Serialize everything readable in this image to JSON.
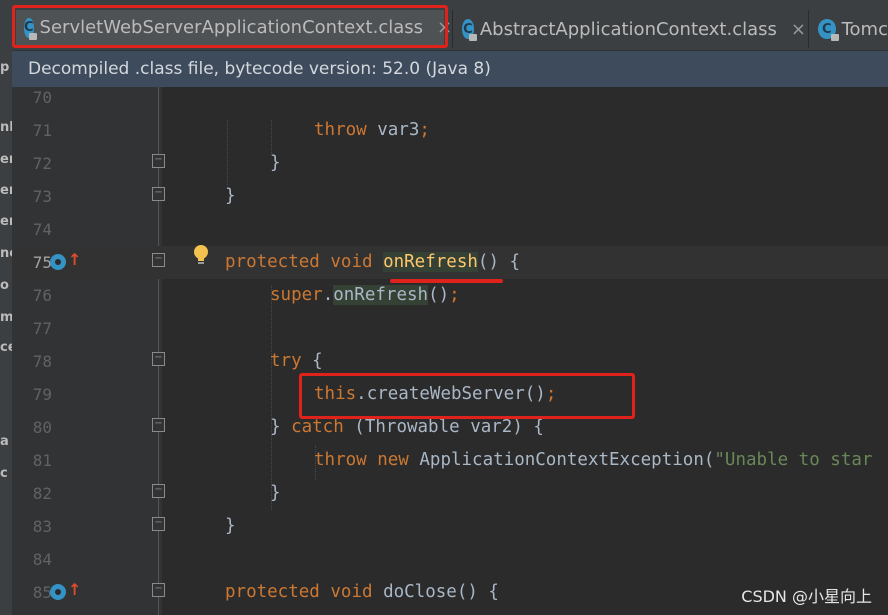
{
  "sidebar_fragments": [
    "p",
    "nl",
    "er",
    "er",
    "er",
    "ne",
    "o",
    "m",
    "ce",
    "a",
    "c"
  ],
  "tabs": [
    {
      "label": "ServletWebServerApplicationContext.class",
      "close": "×",
      "active": true
    },
    {
      "label": "AbstractApplicationContext.class",
      "close": "×",
      "active": false
    },
    {
      "label": "Tomc",
      "active": false
    }
  ],
  "banner": "Decompiled .class file, bytecode version: 52.0 (Java 8)",
  "lines": {
    "l70": {
      "num": "70"
    },
    "l71": {
      "num": "71",
      "kw": "throw",
      "rest": " var3",
      "semi": ";"
    },
    "l72": {
      "num": "72",
      "text": "}"
    },
    "l73": {
      "num": "73",
      "text": "}"
    },
    "l74": {
      "num": "74"
    },
    "l75": {
      "num": "75",
      "kw1": "protected",
      "kw2": "void",
      "name": "onRefresh",
      "rest": "() {"
    },
    "l76": {
      "num": "76",
      "kw": "super",
      "dot": ".",
      "call": "onRefresh",
      "rest": "()",
      "semi": ";"
    },
    "l77": {
      "num": "77"
    },
    "l78": {
      "num": "78",
      "kw": "try",
      "rest": " {"
    },
    "l79": {
      "num": "79",
      "kw": "this",
      "rest": ".createWebServer()",
      "semi": ";"
    },
    "l80": {
      "num": "80",
      "pre": "} ",
      "kw": "catch",
      "rest": " (Throwable var2) {"
    },
    "l81": {
      "num": "81",
      "kw1": "throw",
      "kw2": "new",
      "rest": " ApplicationContextException(",
      "str": "\"Unable to star"
    },
    "l82": {
      "num": "82",
      "text": "}"
    },
    "l83": {
      "num": "83",
      "text": "}"
    },
    "l84": {
      "num": "84"
    },
    "l85": {
      "num": "85",
      "kw1": "protected",
      "kw2": "void",
      "rest": " doClose() {"
    }
  },
  "fold_glyph": "−",
  "up_arrow": "↑",
  "tab_icon_letter": "C",
  "watermark": "CSDN @小星向上",
  "colors": {
    "keyword": "#cc7832",
    "highlight": "#e0221c",
    "accent": "#4a88c7"
  }
}
